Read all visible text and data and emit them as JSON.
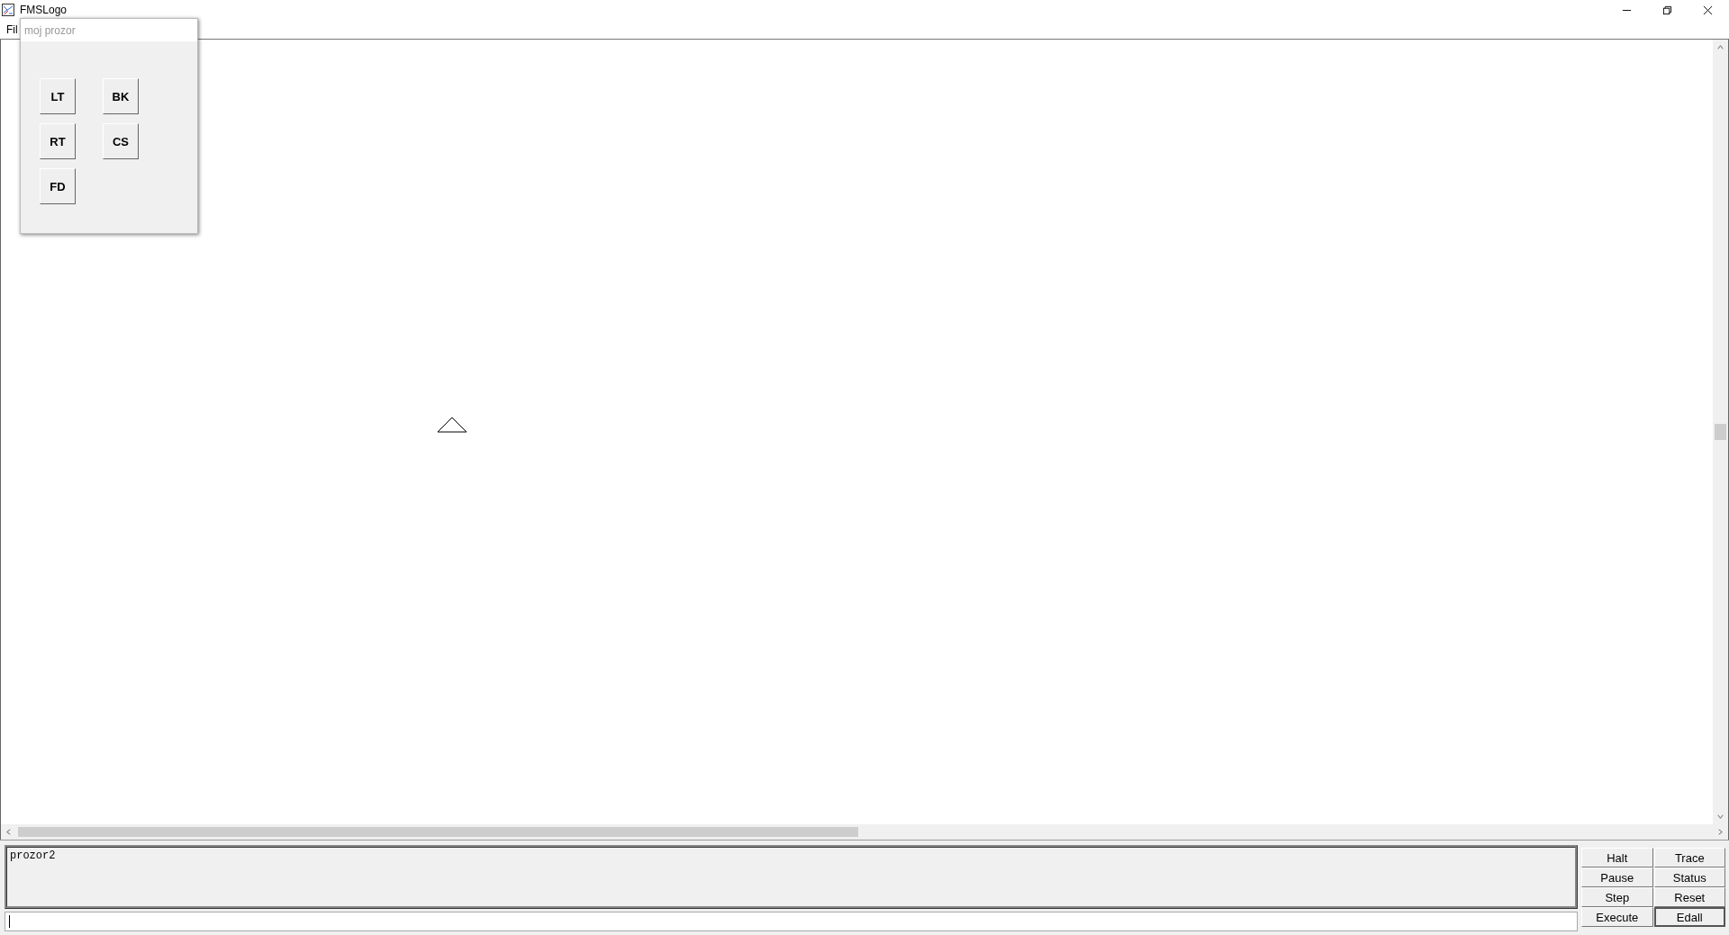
{
  "window": {
    "title": "FMSLogo"
  },
  "menu": [
    "Fil"
  ],
  "popup": {
    "title": "moj prozor",
    "buttons": [
      "LT",
      "BK",
      "RT",
      "CS",
      "FD"
    ]
  },
  "commander": {
    "output": "prozor2",
    "buttons": [
      {
        "label": "Halt",
        "default": false
      },
      {
        "label": "Trace",
        "default": false
      },
      {
        "label": "Pause",
        "default": false
      },
      {
        "label": "Status",
        "default": false
      },
      {
        "label": "Step",
        "default": false
      },
      {
        "label": "Reset",
        "default": false
      },
      {
        "label": "Execute",
        "default": false
      },
      {
        "label": "Edall",
        "default": true
      }
    ]
  }
}
